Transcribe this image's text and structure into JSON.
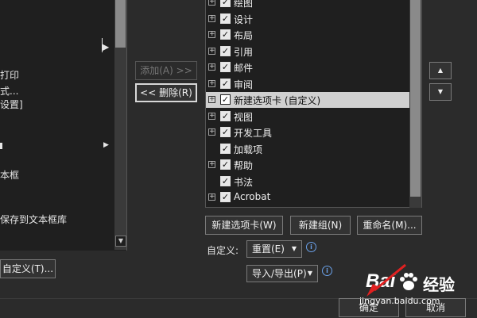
{
  "left_list": {
    "items": [
      "打印",
      "式...",
      "设置]",
      "本框",
      "保存到文本框库"
    ]
  },
  "buttons": {
    "add": "添加(A) >>",
    "remove": "<< 删除(R)",
    "customize_left": "自定义(T)...",
    "new_tab": "新建选项卡(W)",
    "new_group": "新建组(N)",
    "rename": "重命名(M)...",
    "ok": "确定",
    "cancel": "取消"
  },
  "tree": {
    "items": [
      {
        "label": "绘图",
        "expandable": true,
        "checked": true,
        "selected": false
      },
      {
        "label": "设计",
        "expandable": true,
        "checked": true,
        "selected": false
      },
      {
        "label": "布局",
        "expandable": true,
        "checked": true,
        "selected": false
      },
      {
        "label": "引用",
        "expandable": true,
        "checked": true,
        "selected": false
      },
      {
        "label": "邮件",
        "expandable": true,
        "checked": true,
        "selected": false
      },
      {
        "label": "审阅",
        "expandable": true,
        "checked": true,
        "selected": false
      },
      {
        "label": "新建选项卡 (自定义)",
        "expandable": true,
        "checked": true,
        "selected": true
      },
      {
        "label": "视图",
        "expandable": true,
        "checked": true,
        "selected": false
      },
      {
        "label": "开发工具",
        "expandable": true,
        "checked": true,
        "selected": false
      },
      {
        "label": "加载项",
        "expandable": false,
        "checked": true,
        "selected": false
      },
      {
        "label": "帮助",
        "expandable": true,
        "checked": true,
        "selected": false
      },
      {
        "label": "书法",
        "expandable": false,
        "checked": true,
        "selected": false
      },
      {
        "label": "Acrobat",
        "expandable": true,
        "checked": true,
        "selected": false
      }
    ]
  },
  "customize": {
    "label": "自定义:",
    "reset": "重置(E)",
    "import_export": "导入/导出(P)"
  },
  "watermark": {
    "brand": "Bai",
    "brand2": "经验",
    "url": "jingyan.baidu.com"
  },
  "colors": {
    "background": "#2b2b2b",
    "pane": "#1f1f1f",
    "selection": "#d0d0d0",
    "info": "#6aa0e8"
  }
}
